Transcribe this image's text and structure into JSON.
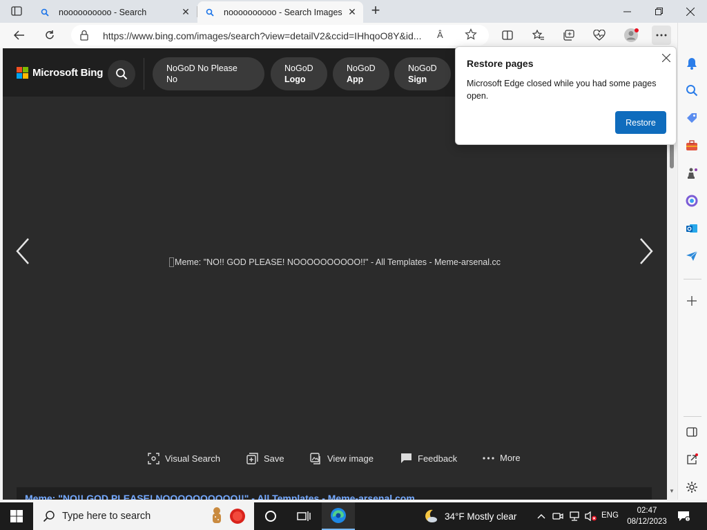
{
  "browser": {
    "tabs": [
      {
        "title": "noooooooooo - Search",
        "active": false
      },
      {
        "title": "noooooooooo - Search Images",
        "active": true
      }
    ],
    "url": "https://www.bing.com/images/search?view=detailV2&ccid=IHhqoO8Y&id...",
    "read_aloud_label": "Â"
  },
  "bing": {
    "logo_text": "Microsoft Bing",
    "logo_colors": [
      "#f25022",
      "#7fba00",
      "#00a4ef",
      "#ffb900"
    ],
    "chips": [
      {
        "line1": "NoGoD No Please No",
        "line2": ""
      },
      {
        "line1": "NoGoD",
        "line2": "Logo"
      },
      {
        "line1": "NoGoD",
        "line2": "App"
      },
      {
        "line1": "NoGoD",
        "line2": "Sign"
      }
    ],
    "image_alt": "Meme: \"NO!! GOD PLEASE! NOOOOOOOOOO!!\" - All Templates - Meme-arsenal.cc",
    "actions": [
      {
        "label": "Visual Search",
        "icon": "visual-search-icon"
      },
      {
        "label": "Save",
        "icon": "save-icon"
      },
      {
        "label": "View image",
        "icon": "view-image-icon"
      },
      {
        "label": "Feedback",
        "icon": "feedback-icon"
      },
      {
        "label": "More",
        "icon": "more-icon"
      }
    ],
    "caption": "Meme: \"NO!! GOD PLEASE! NOOOOOOOOOO!!\" - All Templates - Meme-arsenal.com"
  },
  "popup": {
    "title": "Restore pages",
    "message": "Microsoft Edge closed while you had some pages open.",
    "button": "Restore",
    "accent": "#0f6cbd"
  },
  "taskbar": {
    "search_placeholder": "Type here to search",
    "weather": "34°F  Mostly clear",
    "language": "ENG",
    "time": "02:47",
    "date": "08/12/2023"
  }
}
